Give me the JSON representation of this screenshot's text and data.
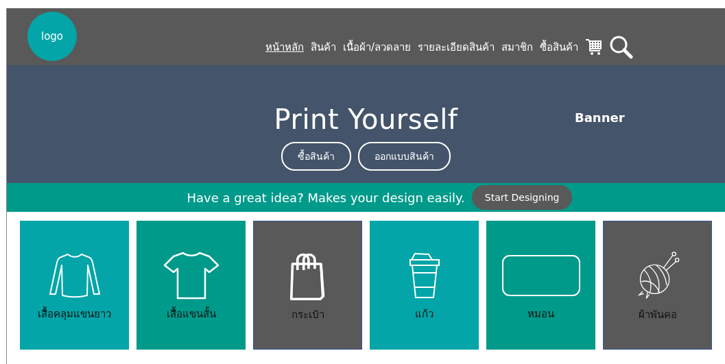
{
  "header": {
    "logo": "logo",
    "nav": [
      {
        "label": "หน้าหลัก",
        "selected": true
      },
      {
        "label": "สินค้า",
        "selected": false
      },
      {
        "label": "เนื้อผ้า/ลวดลาย",
        "selected": false
      },
      {
        "label": "รายละเอียดสินค้า",
        "selected": false
      },
      {
        "label": "สมาชิก",
        "selected": false
      },
      {
        "label": "ซื้อสินค้า",
        "selected": false
      }
    ]
  },
  "banner": {
    "title": "Print Yourself",
    "label": "Banner",
    "buttons": [
      "ซื้อสินค้า",
      "ออกแบบสินค้า"
    ]
  },
  "promo": {
    "text": "Have a great idea? Makes your design easily.",
    "button": "Start Designing"
  },
  "categories": [
    {
      "label": "เสื้อคลุมแขนยาว",
      "kind": "longsleeve",
      "color": "#03a5a8"
    },
    {
      "label": "เสื้อแขนสั้น",
      "kind": "tshirt",
      "color": "#009a8a"
    },
    {
      "label": "กระเป๋า",
      "kind": "bag",
      "color": "#595959"
    },
    {
      "label": "แก้ว",
      "kind": "cup",
      "color": "#03a5a8"
    },
    {
      "label": "หมอน",
      "kind": "pillow",
      "color": "#009a8a"
    },
    {
      "label": "ผ้าพันคอ",
      "kind": "yarn",
      "color": "#595959"
    }
  ]
}
